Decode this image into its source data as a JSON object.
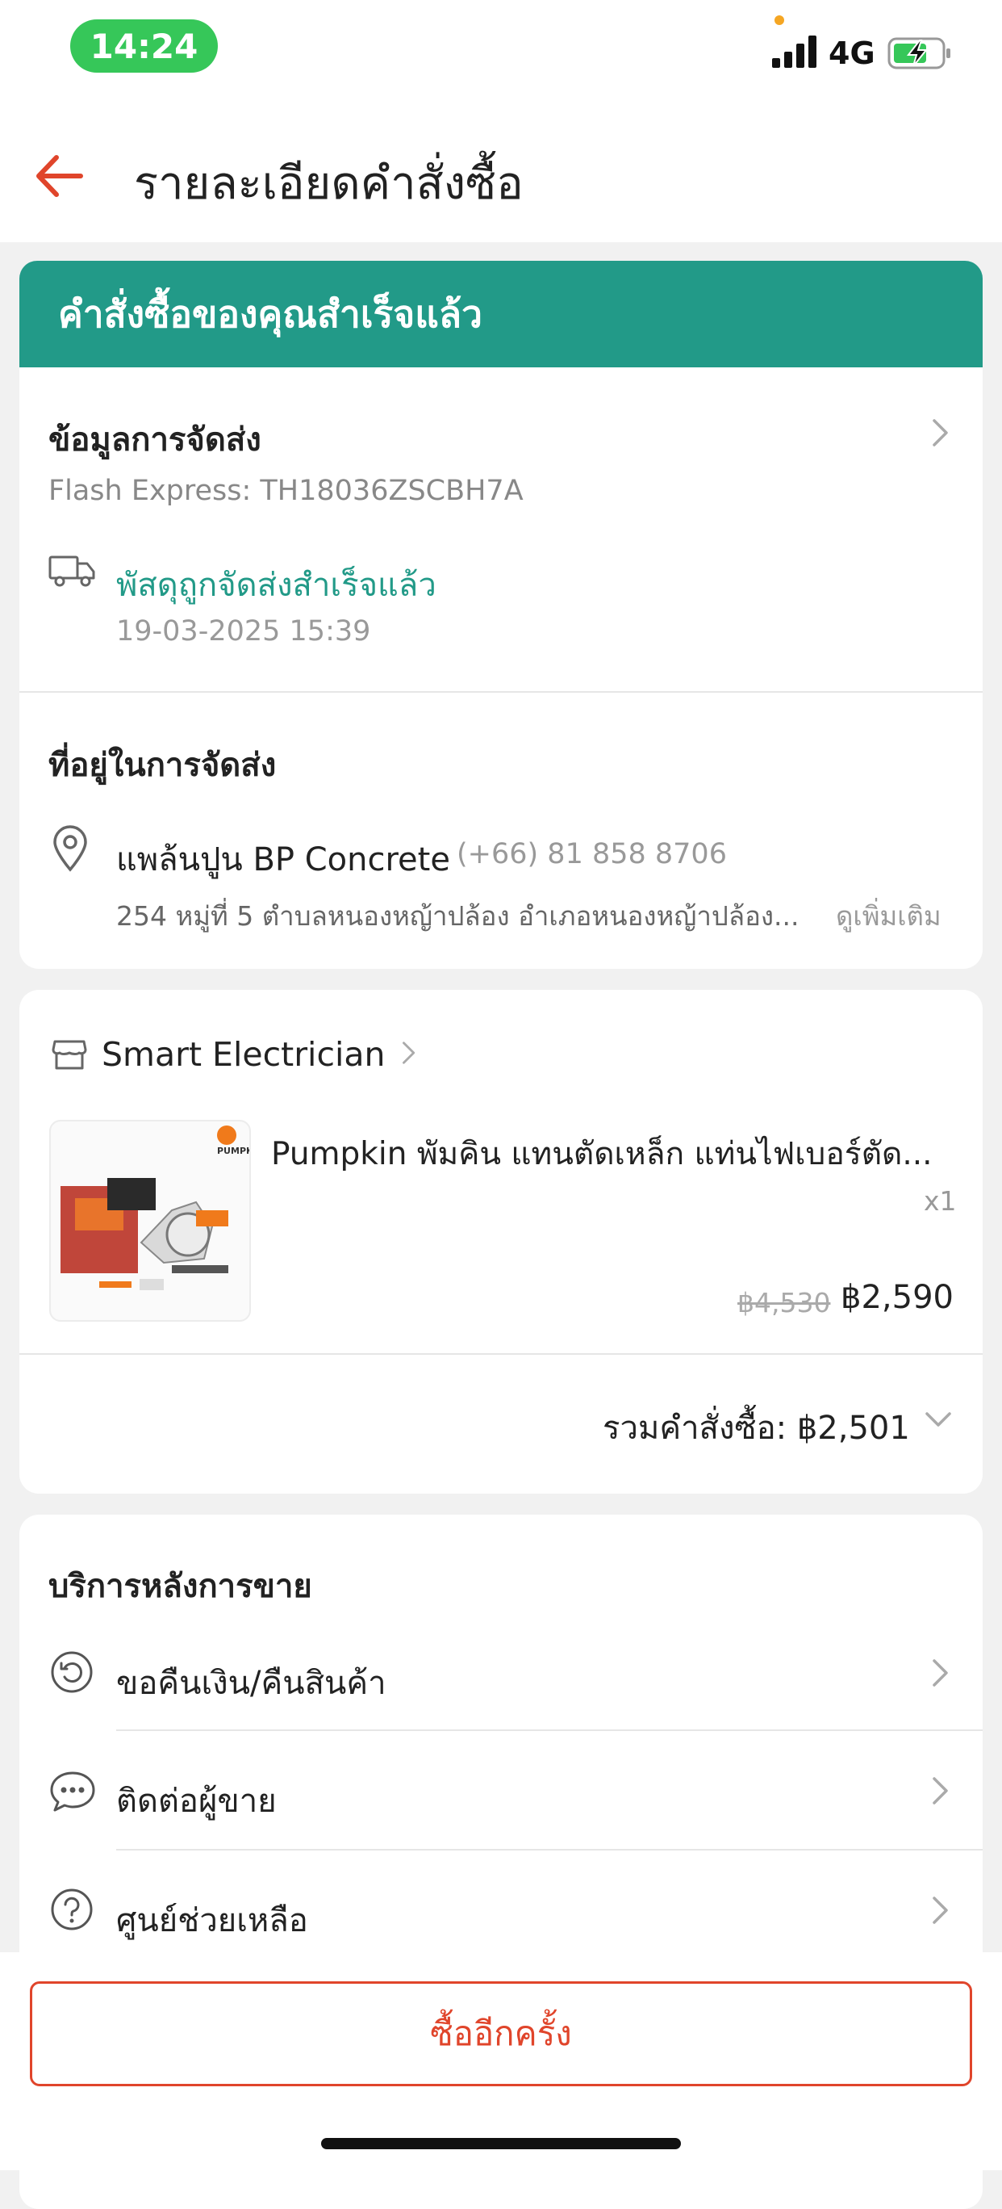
{
  "status_bar": {
    "time": "14:24",
    "network": "4G"
  },
  "header": {
    "title": "รายละเอียดคำสั่งซื้อ"
  },
  "banner": {
    "text": "คำสั่งซื้อของคุณสำเร็จแล้ว"
  },
  "shipping": {
    "heading": "ข้อมูลการจัดส่ง",
    "carrier": "Flash Express: TH18036ZSCBH7A",
    "status": "พัสดุถูกจัดส่งสำเร็จแล้ว",
    "status_time": "19-03-2025 15:39"
  },
  "address": {
    "heading": "ที่อยู่ในการจัดส่ง",
    "name": "แพล้นปูน BP Concrete",
    "phone": "(+66) 81 858 8706",
    "line": "254 หมู่ที่ 5 ตำบลหนองหญ้าปล้อง อำเภอหนองหญ้าปล้อง...",
    "see_more": "ดูเพิ่มเติม"
  },
  "shop": {
    "name": "Smart Electrician"
  },
  "product": {
    "brand_logo": "PUMPKIN",
    "name": "Pumpkin พัมคิน แทนตัดเหล็ก แท่นไฟเบอร์ตัด...",
    "qty": "x1",
    "original_price": "฿4,530",
    "price": "฿2,590"
  },
  "order_total": {
    "label": "รวมคำสั่งซื้อ: ฿2,501"
  },
  "after_sales": {
    "heading": "บริการหลังการขาย",
    "items": [
      {
        "label": "ขอคืนเงิน/คืนสินค้า",
        "icon": "refund-icon"
      },
      {
        "label": "ติดต่อผู้ขาย",
        "icon": "chat-icon"
      },
      {
        "label": "ศูนย์ช่วยเหลือ",
        "icon": "help-icon"
      }
    ]
  },
  "footer": {
    "buy_again": "ซื้ออีกครั้ง"
  },
  "colors": {
    "accent": "#e0452b",
    "banner": "#229a88",
    "delivered": "#229a88",
    "status_pill": "#36c759"
  }
}
